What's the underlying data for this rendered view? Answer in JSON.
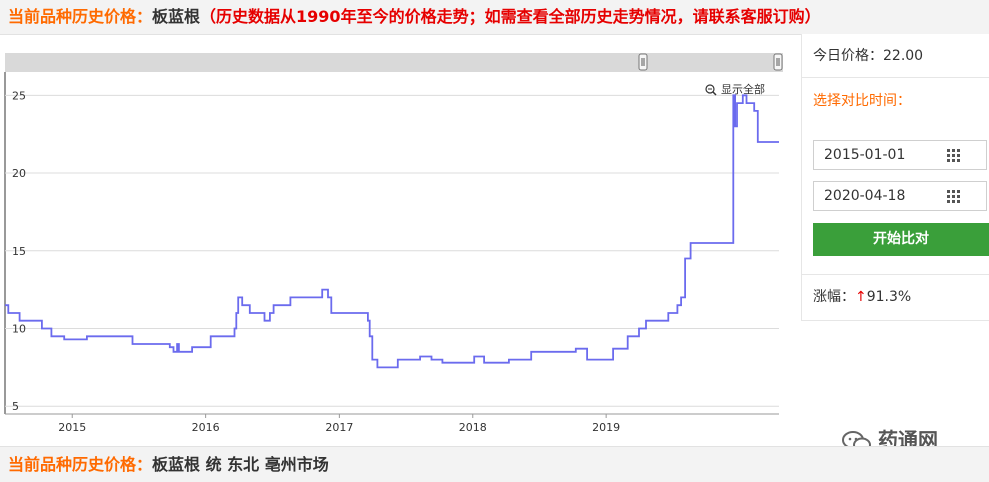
{
  "header": {
    "label": "当前品种历史价格：",
    "herb": "板蓝根",
    "note": "（历史数据从1990年至今的价格走势；如需查看全部历史走势情况，请联系客服订购）"
  },
  "chart": {
    "show_all": "显示全部"
  },
  "chart_data": {
    "type": "line",
    "title": "",
    "xlabel": "",
    "ylabel": "",
    "x_ticks": [
      "2015",
      "2016",
      "2017",
      "2018",
      "2019"
    ],
    "y_ticks": [
      5,
      10,
      15,
      20,
      25
    ],
    "ylim": [
      4.5,
      26.5
    ],
    "xlim": [
      "2014-07-01",
      "2020-04-18"
    ],
    "grid": "horizontal",
    "line_color": "#6b6bee",
    "series": [
      {
        "name": "",
        "points": [
          [
            "2014-07-01",
            11.5
          ],
          [
            "2014-07-10",
            11.0
          ],
          [
            "2014-08-10",
            10.5
          ],
          [
            "2014-10-10",
            10.0
          ],
          [
            "2014-11-05",
            9.5
          ],
          [
            "2014-12-10",
            9.3
          ],
          [
            "2015-02-10",
            9.5
          ],
          [
            "2015-06-15",
            9.0
          ],
          [
            "2015-09-25",
            8.8
          ],
          [
            "2015-10-05",
            8.5
          ],
          [
            "2015-10-15",
            9.0
          ],
          [
            "2015-10-20",
            8.5
          ],
          [
            "2015-11-25",
            8.8
          ],
          [
            "2016-01-15",
            9.5
          ],
          [
            "2016-03-20",
            10.0
          ],
          [
            "2016-03-25",
            11.0
          ],
          [
            "2016-03-30",
            12.0
          ],
          [
            "2016-04-10",
            11.5
          ],
          [
            "2016-05-01",
            11.0
          ],
          [
            "2016-06-10",
            10.5
          ],
          [
            "2016-06-25",
            11.0
          ],
          [
            "2016-07-05",
            11.5
          ],
          [
            "2016-08-20",
            12.0
          ],
          [
            "2016-11-15",
            12.5
          ],
          [
            "2016-12-01",
            12.0
          ],
          [
            "2016-12-10",
            11.0
          ],
          [
            "2017-03-20",
            10.5
          ],
          [
            "2017-03-25",
            9.5
          ],
          [
            "2017-04-01",
            8.0
          ],
          [
            "2017-04-15",
            7.5
          ],
          [
            "2017-06-10",
            8.0
          ],
          [
            "2017-08-10",
            8.2
          ],
          [
            "2017-09-10",
            8.0
          ],
          [
            "2017-10-10",
            7.8
          ],
          [
            "2018-01-05",
            8.2
          ],
          [
            "2018-02-01",
            7.8
          ],
          [
            "2018-04-10",
            8.0
          ],
          [
            "2018-06-10",
            8.5
          ],
          [
            "2018-10-10",
            8.7
          ],
          [
            "2018-11-10",
            8.0
          ],
          [
            "2019-01-20",
            8.7
          ],
          [
            "2019-03-01",
            9.5
          ],
          [
            "2019-04-01",
            10.0
          ],
          [
            "2019-04-20",
            10.5
          ],
          [
            "2019-06-20",
            11.0
          ],
          [
            "2019-07-15",
            11.5
          ],
          [
            "2019-07-25",
            12.0
          ],
          [
            "2019-08-05",
            14.5
          ],
          [
            "2019-08-20",
            15.5
          ],
          [
            "2019-12-15",
            25.0
          ],
          [
            "2019-12-20",
            23.0
          ],
          [
            "2019-12-25",
            24.5
          ],
          [
            "2020-01-10",
            25.0
          ],
          [
            "2020-01-20",
            24.5
          ],
          [
            "2020-02-10",
            24.0
          ],
          [
            "2020-02-20",
            22.0
          ],
          [
            "2020-04-18",
            22.0
          ]
        ]
      }
    ]
  },
  "panel": {
    "price": "今日价格：22.00",
    "compare_title": "选择对比时间：",
    "start_date": "2015-01-01",
    "end_date": "2020-04-18",
    "compare_button": "开始比对",
    "change_label": "涨幅：",
    "change_arrow": "↑",
    "change_value": "91.3%"
  },
  "footer": {
    "label": "当前品种历史价格：",
    "value": "板蓝根 统 东北 亳州市场"
  },
  "watermark": {
    "text": "药通网"
  }
}
